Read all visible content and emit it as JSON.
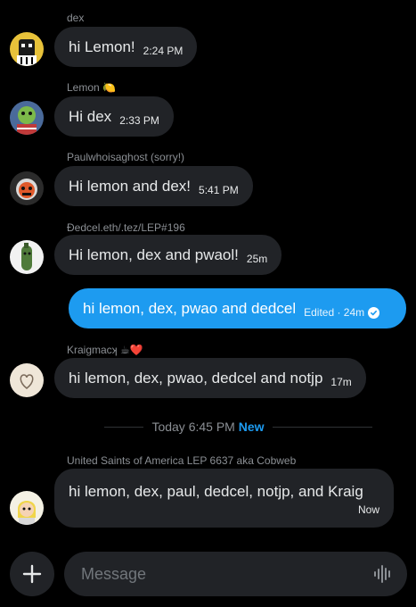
{
  "messages": [
    {
      "sender": "dex",
      "text": "hi Lemon!",
      "time": "2:24 PM"
    },
    {
      "sender": "Lemon 🍋",
      "text": "Hi dex",
      "time": "2:33 PM"
    },
    {
      "sender": "Paulwhoisaghost (sorry!)",
      "text": "Hi lemon and dex!",
      "time": "5:41 PM"
    },
    {
      "sender": "Ðedcel.eth/.tez/LEP#196",
      "text": "Hi lemon, dex and pwaol!",
      "time": "25m"
    },
    {
      "sender": "Kraigmacʞ ☕❤️",
      "text": "hi lemon, dex, pwao, dedcel and notjp",
      "time": "17m"
    },
    {
      "sender": "United Saints of America LEP 6637 aka Cobweb",
      "text": "hi lemon, dex, paul, dedcel, notjp, and Kraig",
      "time": "Now"
    }
  ],
  "own_message": {
    "text": "hi lemon, dex, pwao and dedcel",
    "status": "Edited · 24m"
  },
  "divider": {
    "time": "Today 6:45 PM",
    "badge": "New"
  },
  "composer": {
    "placeholder": "Message"
  },
  "colors": {
    "accent": "#1d9bf0",
    "bubble": "#212327",
    "background": "#000000"
  },
  "icons": [
    "plus-icon",
    "voice-waveform-icon",
    "check-circle-icon"
  ]
}
